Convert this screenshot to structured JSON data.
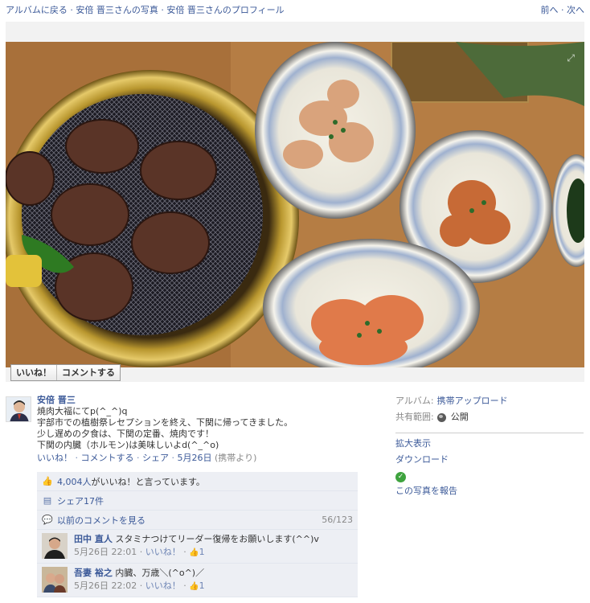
{
  "nav": {
    "back_to_album": "アルバムに戻る",
    "photos_of": "安倍 晋三さんの写真",
    "profile_of": "安倍 晋三さんのプロフィール",
    "separator": " · ",
    "prev": "前へ",
    "next": "次へ",
    "prev_next_sep": " · "
  },
  "photo_actions": {
    "like": "いいね！",
    "comment": "コメントする"
  },
  "post": {
    "author": "安倍 晋三",
    "lines": [
      "焼肉大福にてp(^_^)q",
      "宇部市での植樹祭レセプションを終え、下関に帰ってきました。",
      "少し遅めの夕食は、下関の定番、焼肉です！",
      "下関の内臓（ホルモン)は美味しいよd(^_^o)"
    ],
    "meta": {
      "like": "いいね！",
      "comment": "コメントする",
      "share": "シェア",
      "date": "5月26日",
      "via": "(携帯より)",
      "sep": " · "
    }
  },
  "ufi": {
    "likes_count": "4,004人",
    "likes_text": "がいいね！と言っています。",
    "shares": "シェア17件",
    "prev_comments": "以前のコメントを見る",
    "comment_count": "56/123",
    "comments": [
      {
        "name": "田中 直人",
        "text": "スタミナつけてリーダー復帰をお願いします(^^)v",
        "time": "5月26日 22:01",
        "like": "いいね！",
        "likes": "1"
      },
      {
        "name": "吾妻 裕之",
        "text": "内臓、万歳＼(^o^)／",
        "time": "5月26日 22:02",
        "like": "いいね！",
        "likes": "1"
      }
    ]
  },
  "side": {
    "album_label": "アルバム:",
    "album_value": "携帯アップロード",
    "privacy_label": "共有範囲:",
    "privacy_value": "公開",
    "enlarge": "拡大表示",
    "download": "ダウンロード",
    "report": "この写真を報告"
  },
  "colors": {
    "link": "#3b5998",
    "ufi_bg": "#edeff4",
    "stage_bg": "#f2f2f2"
  }
}
